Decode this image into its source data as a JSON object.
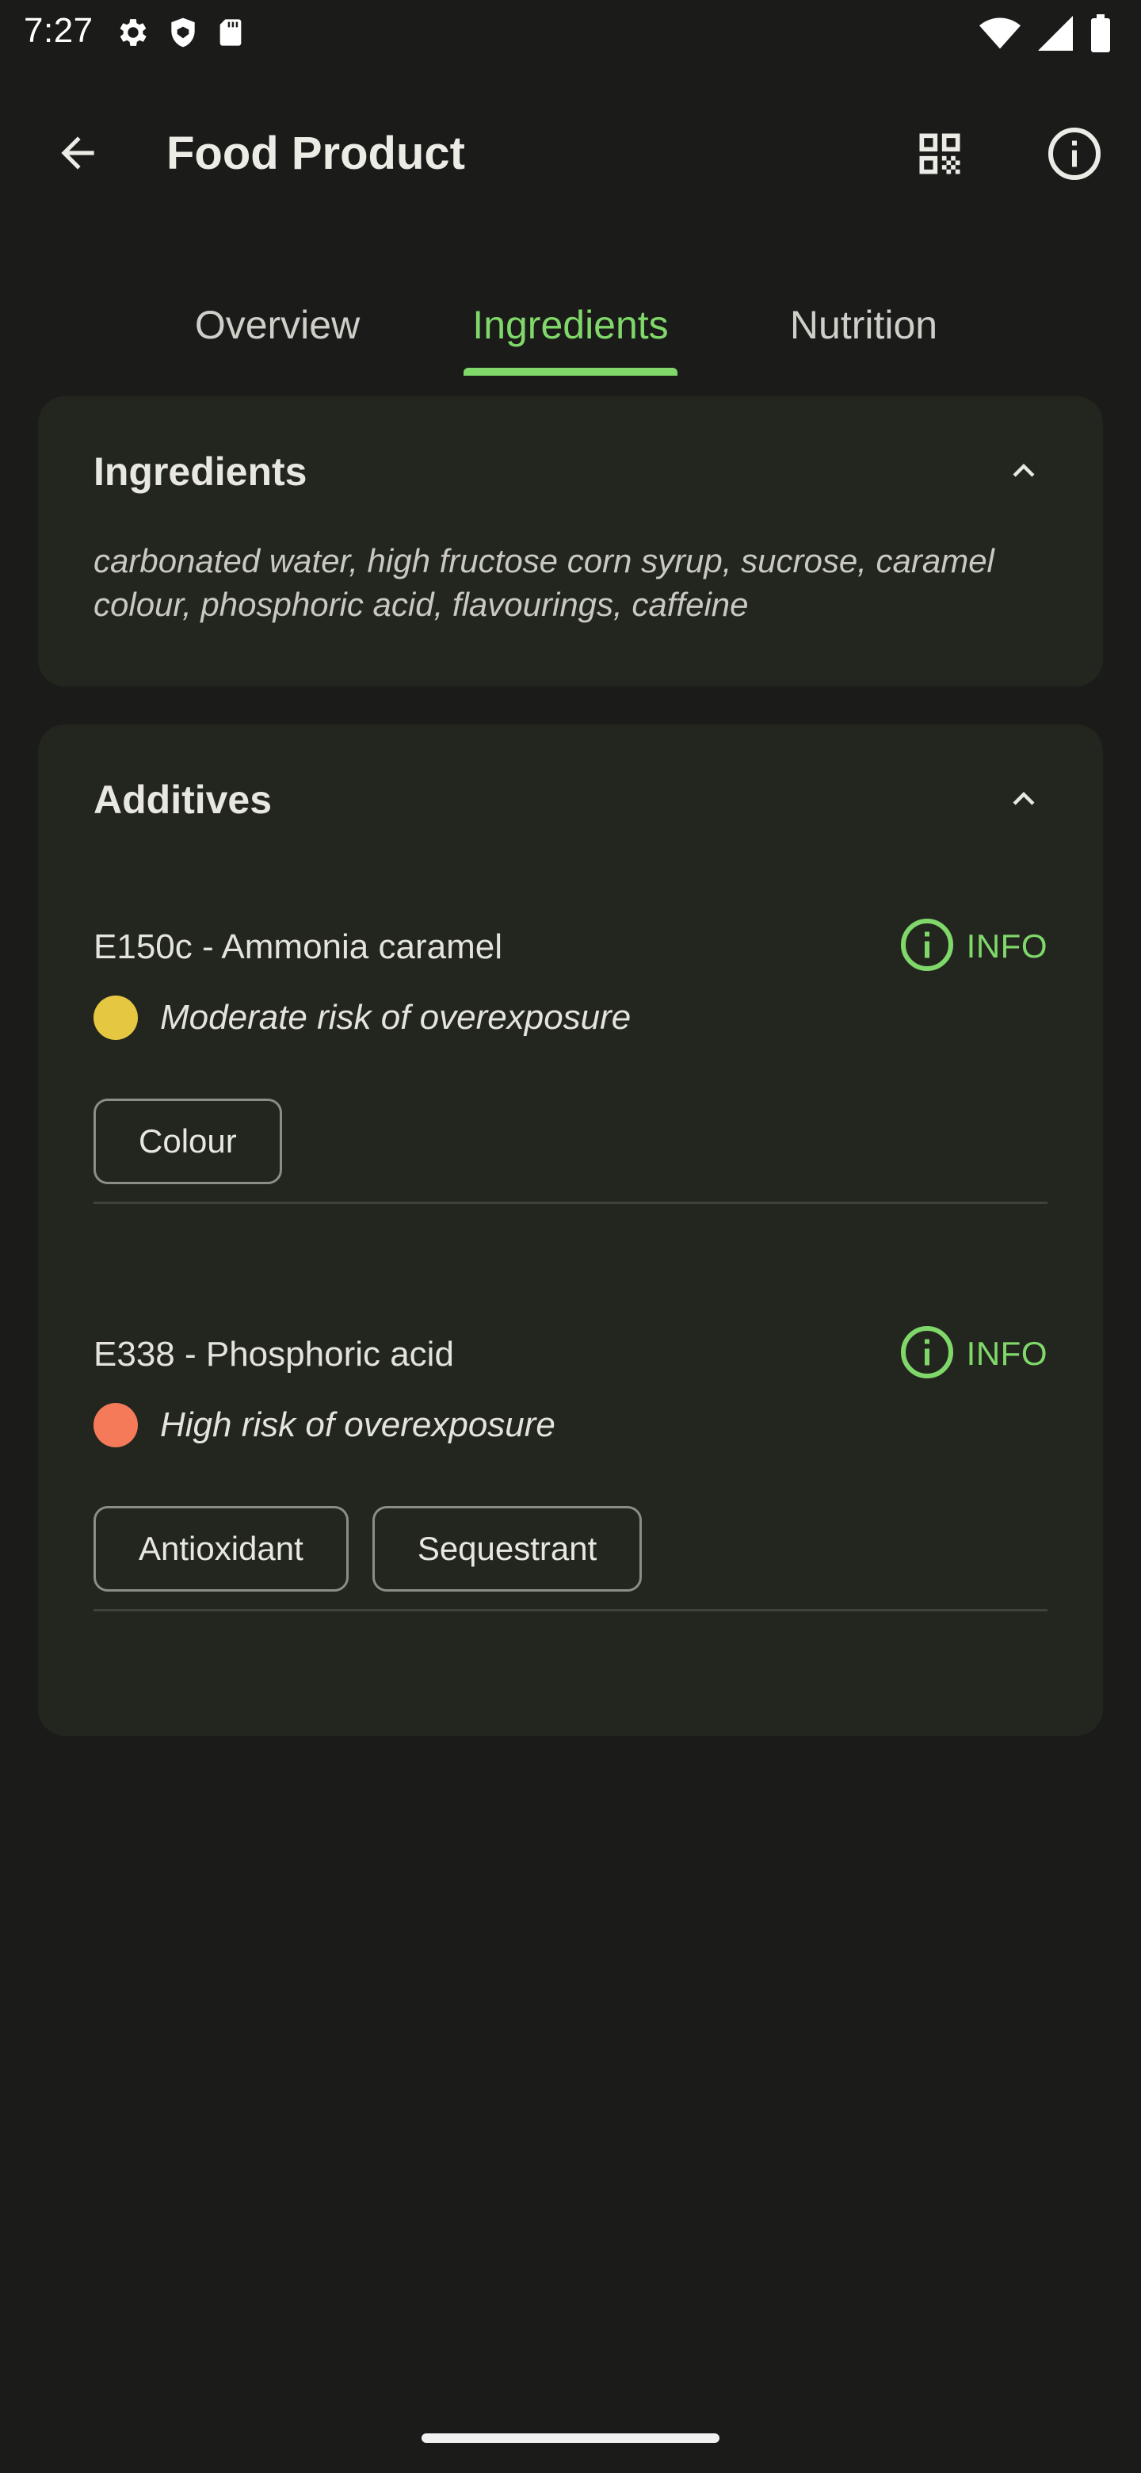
{
  "status_bar": {
    "time": "7:27",
    "icons_left": [
      "gear-icon",
      "shield-icon",
      "sd-card-icon"
    ],
    "icons_right": [
      "wifi-icon",
      "signal-icon",
      "battery-icon"
    ]
  },
  "app_bar": {
    "title": "Food Product",
    "back_icon": "arrow-back-icon",
    "actions": [
      "qr-code-icon",
      "info-icon"
    ]
  },
  "tabs": [
    {
      "label": "Overview",
      "active": false
    },
    {
      "label": "Ingredients",
      "active": true
    },
    {
      "label": "Nutrition",
      "active": false
    }
  ],
  "ingredients_card": {
    "title": "Ingredients",
    "text": "carbonated water, high fructose corn syrup, sucrose, caramel colour, phosphoric acid, flavourings, caffeine"
  },
  "additives_card": {
    "title": "Additives",
    "items": [
      {
        "name": "E150c - Ammonia caramel",
        "info_label": "INFO",
        "risk": "Moderate risk of overexposure",
        "risk_color": "#e6c742",
        "tags": [
          "Colour"
        ]
      },
      {
        "name": "E338 - Phosphoric acid",
        "info_label": "INFO",
        "risk": "High risk of overexposure",
        "risk_color": "#f47a5a",
        "tags": [
          "Antioxidant",
          "Sequestrant"
        ]
      }
    ]
  },
  "colors": {
    "background": "#1b1c1a",
    "card": "#22261f",
    "accent": "#80d86a"
  }
}
